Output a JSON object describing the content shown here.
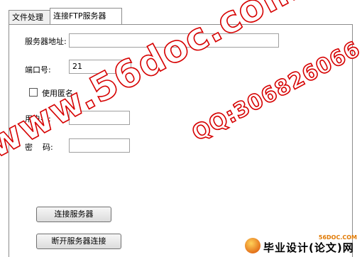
{
  "tabs": [
    {
      "label": "文件处理"
    },
    {
      "label": "连接FTP服务器"
    }
  ],
  "form": {
    "server_label": "服务器地址:",
    "server_value": "",
    "port_label": "端口号:",
    "port_value": "21",
    "anonymous_label": "使用匿名",
    "anonymous_checked": false,
    "user_label": "用户名:",
    "user_value": "",
    "password_label": "密    码:",
    "password_value": ""
  },
  "buttons": {
    "connect_label": "连接服务器",
    "disconnect_label": "断开服务器连接"
  },
  "watermarks": {
    "site": "www.56doc.com",
    "qq": "QQ:306826066"
  },
  "badge": {
    "site": "56DOC.COM",
    "text": "毕业设计(论文)网"
  }
}
